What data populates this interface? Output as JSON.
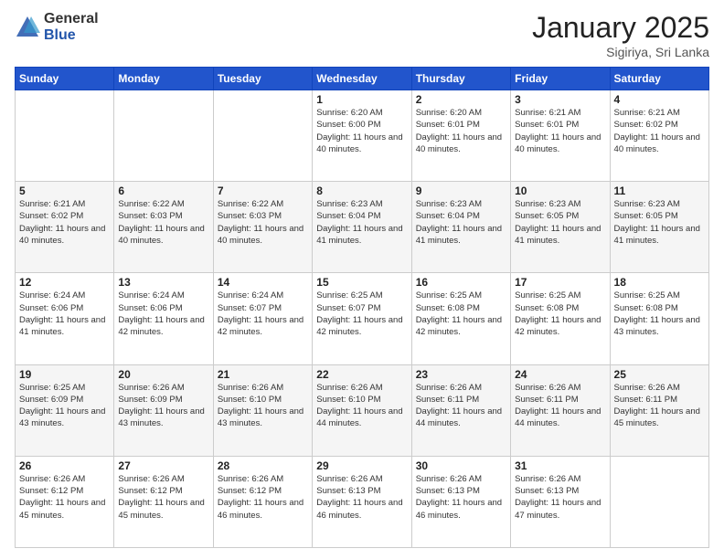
{
  "logo": {
    "general": "General",
    "blue": "Blue"
  },
  "header": {
    "month": "January 2025",
    "location": "Sigiriya, Sri Lanka"
  },
  "weekdays": [
    "Sunday",
    "Monday",
    "Tuesday",
    "Wednesday",
    "Thursday",
    "Friday",
    "Saturday"
  ],
  "weeks": [
    [
      {
        "day": "",
        "sunrise": "",
        "sunset": "",
        "daylight": ""
      },
      {
        "day": "",
        "sunrise": "",
        "sunset": "",
        "daylight": ""
      },
      {
        "day": "",
        "sunrise": "",
        "sunset": "",
        "daylight": ""
      },
      {
        "day": "1",
        "sunrise": "Sunrise: 6:20 AM",
        "sunset": "Sunset: 6:00 PM",
        "daylight": "Daylight: 11 hours and 40 minutes."
      },
      {
        "day": "2",
        "sunrise": "Sunrise: 6:20 AM",
        "sunset": "Sunset: 6:01 PM",
        "daylight": "Daylight: 11 hours and 40 minutes."
      },
      {
        "day": "3",
        "sunrise": "Sunrise: 6:21 AM",
        "sunset": "Sunset: 6:01 PM",
        "daylight": "Daylight: 11 hours and 40 minutes."
      },
      {
        "day": "4",
        "sunrise": "Sunrise: 6:21 AM",
        "sunset": "Sunset: 6:02 PM",
        "daylight": "Daylight: 11 hours and 40 minutes."
      }
    ],
    [
      {
        "day": "5",
        "sunrise": "Sunrise: 6:21 AM",
        "sunset": "Sunset: 6:02 PM",
        "daylight": "Daylight: 11 hours and 40 minutes."
      },
      {
        "day": "6",
        "sunrise": "Sunrise: 6:22 AM",
        "sunset": "Sunset: 6:03 PM",
        "daylight": "Daylight: 11 hours and 40 minutes."
      },
      {
        "day": "7",
        "sunrise": "Sunrise: 6:22 AM",
        "sunset": "Sunset: 6:03 PM",
        "daylight": "Daylight: 11 hours and 40 minutes."
      },
      {
        "day": "8",
        "sunrise": "Sunrise: 6:23 AM",
        "sunset": "Sunset: 6:04 PM",
        "daylight": "Daylight: 11 hours and 41 minutes."
      },
      {
        "day": "9",
        "sunrise": "Sunrise: 6:23 AM",
        "sunset": "Sunset: 6:04 PM",
        "daylight": "Daylight: 11 hours and 41 minutes."
      },
      {
        "day": "10",
        "sunrise": "Sunrise: 6:23 AM",
        "sunset": "Sunset: 6:05 PM",
        "daylight": "Daylight: 11 hours and 41 minutes."
      },
      {
        "day": "11",
        "sunrise": "Sunrise: 6:23 AM",
        "sunset": "Sunset: 6:05 PM",
        "daylight": "Daylight: 11 hours and 41 minutes."
      }
    ],
    [
      {
        "day": "12",
        "sunrise": "Sunrise: 6:24 AM",
        "sunset": "Sunset: 6:06 PM",
        "daylight": "Daylight: 11 hours and 41 minutes."
      },
      {
        "day": "13",
        "sunrise": "Sunrise: 6:24 AM",
        "sunset": "Sunset: 6:06 PM",
        "daylight": "Daylight: 11 hours and 42 minutes."
      },
      {
        "day": "14",
        "sunrise": "Sunrise: 6:24 AM",
        "sunset": "Sunset: 6:07 PM",
        "daylight": "Daylight: 11 hours and 42 minutes."
      },
      {
        "day": "15",
        "sunrise": "Sunrise: 6:25 AM",
        "sunset": "Sunset: 6:07 PM",
        "daylight": "Daylight: 11 hours and 42 minutes."
      },
      {
        "day": "16",
        "sunrise": "Sunrise: 6:25 AM",
        "sunset": "Sunset: 6:08 PM",
        "daylight": "Daylight: 11 hours and 42 minutes."
      },
      {
        "day": "17",
        "sunrise": "Sunrise: 6:25 AM",
        "sunset": "Sunset: 6:08 PM",
        "daylight": "Daylight: 11 hours and 42 minutes."
      },
      {
        "day": "18",
        "sunrise": "Sunrise: 6:25 AM",
        "sunset": "Sunset: 6:08 PM",
        "daylight": "Daylight: 11 hours and 43 minutes."
      }
    ],
    [
      {
        "day": "19",
        "sunrise": "Sunrise: 6:25 AM",
        "sunset": "Sunset: 6:09 PM",
        "daylight": "Daylight: 11 hours and 43 minutes."
      },
      {
        "day": "20",
        "sunrise": "Sunrise: 6:26 AM",
        "sunset": "Sunset: 6:09 PM",
        "daylight": "Daylight: 11 hours and 43 minutes."
      },
      {
        "day": "21",
        "sunrise": "Sunrise: 6:26 AM",
        "sunset": "Sunset: 6:10 PM",
        "daylight": "Daylight: 11 hours and 43 minutes."
      },
      {
        "day": "22",
        "sunrise": "Sunrise: 6:26 AM",
        "sunset": "Sunset: 6:10 PM",
        "daylight": "Daylight: 11 hours and 44 minutes."
      },
      {
        "day": "23",
        "sunrise": "Sunrise: 6:26 AM",
        "sunset": "Sunset: 6:11 PM",
        "daylight": "Daylight: 11 hours and 44 minutes."
      },
      {
        "day": "24",
        "sunrise": "Sunrise: 6:26 AM",
        "sunset": "Sunset: 6:11 PM",
        "daylight": "Daylight: 11 hours and 44 minutes."
      },
      {
        "day": "25",
        "sunrise": "Sunrise: 6:26 AM",
        "sunset": "Sunset: 6:11 PM",
        "daylight": "Daylight: 11 hours and 45 minutes."
      }
    ],
    [
      {
        "day": "26",
        "sunrise": "Sunrise: 6:26 AM",
        "sunset": "Sunset: 6:12 PM",
        "daylight": "Daylight: 11 hours and 45 minutes."
      },
      {
        "day": "27",
        "sunrise": "Sunrise: 6:26 AM",
        "sunset": "Sunset: 6:12 PM",
        "daylight": "Daylight: 11 hours and 45 minutes."
      },
      {
        "day": "28",
        "sunrise": "Sunrise: 6:26 AM",
        "sunset": "Sunset: 6:12 PM",
        "daylight": "Daylight: 11 hours and 46 minutes."
      },
      {
        "day": "29",
        "sunrise": "Sunrise: 6:26 AM",
        "sunset": "Sunset: 6:13 PM",
        "daylight": "Daylight: 11 hours and 46 minutes."
      },
      {
        "day": "30",
        "sunrise": "Sunrise: 6:26 AM",
        "sunset": "Sunset: 6:13 PM",
        "daylight": "Daylight: 11 hours and 46 minutes."
      },
      {
        "day": "31",
        "sunrise": "Sunrise: 6:26 AM",
        "sunset": "Sunset: 6:13 PM",
        "daylight": "Daylight: 11 hours and 47 minutes."
      },
      {
        "day": "",
        "sunrise": "",
        "sunset": "",
        "daylight": ""
      }
    ]
  ]
}
